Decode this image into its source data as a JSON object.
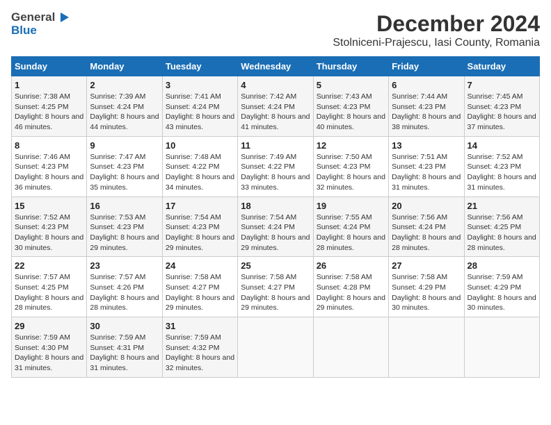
{
  "header": {
    "logo_general": "General",
    "logo_blue": "Blue",
    "main_title": "December 2024",
    "subtitle": "Stolniceni-Prajescu, Iasi County, Romania"
  },
  "calendar": {
    "headers": [
      "Sunday",
      "Monday",
      "Tuesday",
      "Wednesday",
      "Thursday",
      "Friday",
      "Saturday"
    ],
    "weeks": [
      [
        {
          "day": "",
          "info": ""
        },
        {
          "day": "2",
          "info": "Sunrise: 7:39 AM\nSunset: 4:24 PM\nDaylight: 8 hours and 44 minutes."
        },
        {
          "day": "3",
          "info": "Sunrise: 7:41 AM\nSunset: 4:24 PM\nDaylight: 8 hours and 43 minutes."
        },
        {
          "day": "4",
          "info": "Sunrise: 7:42 AM\nSunset: 4:24 PM\nDaylight: 8 hours and 41 minutes."
        },
        {
          "day": "5",
          "info": "Sunrise: 7:43 AM\nSunset: 4:23 PM\nDaylight: 8 hours and 40 minutes."
        },
        {
          "day": "6",
          "info": "Sunrise: 7:44 AM\nSunset: 4:23 PM\nDaylight: 8 hours and 38 minutes."
        },
        {
          "day": "7",
          "info": "Sunrise: 7:45 AM\nSunset: 4:23 PM\nDaylight: 8 hours and 37 minutes."
        }
      ],
      [
        {
          "day": "1",
          "info": "Sunrise: 7:38 AM\nSunset: 4:25 PM\nDaylight: 8 hours and 46 minutes."
        },
        {
          "day": "9",
          "info": "Sunrise: 7:47 AM\nSunset: 4:23 PM\nDaylight: 8 hours and 35 minutes."
        },
        {
          "day": "10",
          "info": "Sunrise: 7:48 AM\nSunset: 4:22 PM\nDaylight: 8 hours and 34 minutes."
        },
        {
          "day": "11",
          "info": "Sunrise: 7:49 AM\nSunset: 4:22 PM\nDaylight: 8 hours and 33 minutes."
        },
        {
          "day": "12",
          "info": "Sunrise: 7:50 AM\nSunset: 4:23 PM\nDaylight: 8 hours and 32 minutes."
        },
        {
          "day": "13",
          "info": "Sunrise: 7:51 AM\nSunset: 4:23 PM\nDaylight: 8 hours and 31 minutes."
        },
        {
          "day": "14",
          "info": "Sunrise: 7:52 AM\nSunset: 4:23 PM\nDaylight: 8 hours and 31 minutes."
        }
      ],
      [
        {
          "day": "8",
          "info": "Sunrise: 7:46 AM\nSunset: 4:23 PM\nDaylight: 8 hours and 36 minutes."
        },
        {
          "day": "16",
          "info": "Sunrise: 7:53 AM\nSunset: 4:23 PM\nDaylight: 8 hours and 29 minutes."
        },
        {
          "day": "17",
          "info": "Sunrise: 7:54 AM\nSunset: 4:23 PM\nDaylight: 8 hours and 29 minutes."
        },
        {
          "day": "18",
          "info": "Sunrise: 7:54 AM\nSunset: 4:24 PM\nDaylight: 8 hours and 29 minutes."
        },
        {
          "day": "19",
          "info": "Sunrise: 7:55 AM\nSunset: 4:24 PM\nDaylight: 8 hours and 28 minutes."
        },
        {
          "day": "20",
          "info": "Sunrise: 7:56 AM\nSunset: 4:24 PM\nDaylight: 8 hours and 28 minutes."
        },
        {
          "day": "21",
          "info": "Sunrise: 7:56 AM\nSunset: 4:25 PM\nDaylight: 8 hours and 28 minutes."
        }
      ],
      [
        {
          "day": "15",
          "info": "Sunrise: 7:52 AM\nSunset: 4:23 PM\nDaylight: 8 hours and 30 minutes."
        },
        {
          "day": "23",
          "info": "Sunrise: 7:57 AM\nSunset: 4:26 PM\nDaylight: 8 hours and 28 minutes."
        },
        {
          "day": "24",
          "info": "Sunrise: 7:58 AM\nSunset: 4:27 PM\nDaylight: 8 hours and 29 minutes."
        },
        {
          "day": "25",
          "info": "Sunrise: 7:58 AM\nSunset: 4:27 PM\nDaylight: 8 hours and 29 minutes."
        },
        {
          "day": "26",
          "info": "Sunrise: 7:58 AM\nSunset: 4:28 PM\nDaylight: 8 hours and 29 minutes."
        },
        {
          "day": "27",
          "info": "Sunrise: 7:58 AM\nSunset: 4:29 PM\nDaylight: 8 hours and 30 minutes."
        },
        {
          "day": "28",
          "info": "Sunrise: 7:59 AM\nSunset: 4:29 PM\nDaylight: 8 hours and 30 minutes."
        }
      ],
      [
        {
          "day": "22",
          "info": "Sunrise: 7:57 AM\nSunset: 4:25 PM\nDaylight: 8 hours and 28 minutes."
        },
        {
          "day": "30",
          "info": "Sunrise: 7:59 AM\nSunset: 4:31 PM\nDaylight: 8 hours and 31 minutes."
        },
        {
          "day": "31",
          "info": "Sunrise: 7:59 AM\nSunset: 4:32 PM\nDaylight: 8 hours and 32 minutes."
        },
        {
          "day": "",
          "info": ""
        },
        {
          "day": "",
          "info": ""
        },
        {
          "day": "",
          "info": ""
        },
        {
          "day": "",
          "info": ""
        }
      ],
      [
        {
          "day": "29",
          "info": "Sunrise: 7:59 AM\nSunset: 4:30 PM\nDaylight: 8 hours and 31 minutes."
        },
        {
          "day": "",
          "info": ""
        },
        {
          "day": "",
          "info": ""
        },
        {
          "day": "",
          "info": ""
        },
        {
          "day": "",
          "info": ""
        },
        {
          "day": "",
          "info": ""
        },
        {
          "day": "",
          "info": ""
        }
      ]
    ]
  }
}
